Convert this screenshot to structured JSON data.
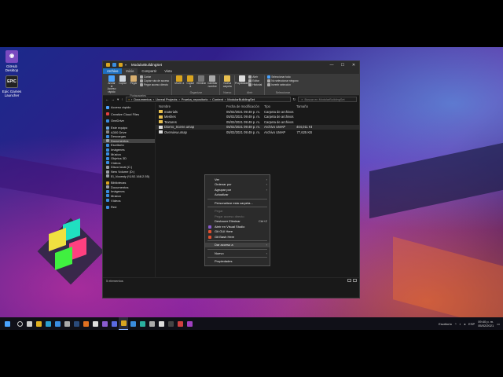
{
  "window": {
    "title": "ModularBuildingSet",
    "path": [
      "Documentos",
      "Unreal Projects",
      "Prueba_repositorio",
      "Content",
      "ModularBuildingSet"
    ],
    "search_placeholder": "Buscar en ModularBuildingSet",
    "status": "5 elementos"
  },
  "ribbon": {
    "tabs": [
      "Archivo",
      "Inicio",
      "Compartir",
      "Vista"
    ],
    "active_tab": "Inicio",
    "groups": [
      {
        "label": "Portapapeles",
        "buttons": [
          "Anclar al Acceso rápido",
          "Copiar",
          "Pegar"
        ],
        "small": [
          "Cortar",
          "Copiar ruta de acceso",
          "Pegar acceso directo"
        ]
      },
      {
        "label": "Organizar",
        "buttons": [
          "Mover a",
          "Copiar a",
          "Eliminar",
          "Cambiar nombre"
        ],
        "small": []
      },
      {
        "label": "Nuevo",
        "buttons": [
          "Nueva carpeta"
        ],
        "small": []
      },
      {
        "label": "Abrir",
        "buttons": [
          "Propiedades"
        ],
        "small": [
          "Abrir",
          "Editar",
          "Historial"
        ]
      },
      {
        "label": "Seleccionar",
        "buttons": [],
        "small": [
          "Seleccionar todo",
          "No seleccionar ninguno",
          "Invertir selección"
        ]
      }
    ]
  },
  "nav": [
    {
      "label": "Acceso rápido",
      "color": "#4aa3ff",
      "gap": false
    },
    {
      "label": "Creative Cloud Files",
      "color": "#e04040",
      "gap": true
    },
    {
      "label": "OneDrive",
      "color": "#3a8de0",
      "gap": true
    },
    {
      "label": "Este equipo",
      "color": "#6aa8e0",
      "gap": true
    },
    {
      "label": "A300 Drive",
      "color": "#888888",
      "gap": false
    },
    {
      "label": "Descargas",
      "color": "#3a8de0",
      "gap": false
    },
    {
      "label": "Documentos",
      "color": "#9aa0a8",
      "gap": false,
      "selected": true
    },
    {
      "label": "Escritorio",
      "color": "#3a8de0",
      "gap": false
    },
    {
      "label": "Imágenes",
      "color": "#3a8de0",
      "gap": false
    },
    {
      "label": "Música",
      "color": "#3a8de0",
      "gap": false
    },
    {
      "label": "Objetos 3D",
      "color": "#3a8de0",
      "gap": false
    },
    {
      "label": "Vídeos",
      "color": "#3a8de0",
      "gap": false
    },
    {
      "label": "Disco local (C:)",
      "color": "#9aa0a8",
      "gap": false
    },
    {
      "label": "New Volume (D:)",
      "color": "#9aa0a8",
      "gap": false
    },
    {
      "label": "El_Vocesty (\\\\192.168.2.55)",
      "color": "#9aa0a8",
      "gap": false
    },
    {
      "label": "Bibliotecas",
      "color": "#d9a520",
      "gap": true
    },
    {
      "label": "Documentos",
      "color": "#9aa0a8",
      "gap": false
    },
    {
      "label": "Imágenes",
      "color": "#3a8de0",
      "gap": false
    },
    {
      "label": "Música",
      "color": "#3a8de0",
      "gap": false
    },
    {
      "label": "Vídeos",
      "color": "#3a8de0",
      "gap": false
    },
    {
      "label": "Red",
      "color": "#3a8de0",
      "gap": true
    }
  ],
  "columns": [
    "Nombre",
    "Fecha de modificación",
    "Tipo",
    "Tamaño"
  ],
  "files": [
    {
      "name": "materials",
      "date": "05/02/2021 09:49 p. m.",
      "type": "Carpeta de archivos",
      "size": "",
      "kind": "folder"
    },
    {
      "name": "Meshes",
      "date": "05/02/2021 09:49 p. m.",
      "type": "Carpeta de archivos",
      "size": "",
      "kind": "folder"
    },
    {
      "name": "Textures",
      "date": "05/02/2021 09:49 p. m.",
      "type": "Carpeta de archivos",
      "size": "",
      "kind": "folder"
    },
    {
      "name": "Diorno_Scene.umap",
      "date": "05/02/2021 09:49 p. m.",
      "type": "Archivo UMAP",
      "size": "404,011 KB",
      "kind": "file"
    },
    {
      "name": "Overview.umap",
      "date": "05/02/2021 09:49 p. m.",
      "type": "Archivo UMAP",
      "size": "77,625 KB",
      "kind": "file"
    }
  ],
  "context_menu": [
    {
      "label": "Ver",
      "arrow": true
    },
    {
      "label": "Ordenar por",
      "arrow": true
    },
    {
      "label": "Agrupar por",
      "arrow": true
    },
    {
      "label": "Actualizar"
    },
    {
      "sep": true
    },
    {
      "label": "Personalizar esta carpeta..."
    },
    {
      "sep": true
    },
    {
      "label": "Pegar",
      "disabled": true
    },
    {
      "label": "Pegar acceso directo",
      "disabled": true
    },
    {
      "label": "Deshacer Eliminar",
      "shortcut": "Ctrl+Z"
    },
    {
      "label": "Abrir en Visual Studio",
      "icon": "#8a5cd0"
    },
    {
      "label": "Git GUI Here",
      "icon": "#e05030"
    },
    {
      "label": "Git Bash Here",
      "icon": "#e05030"
    },
    {
      "sep": true
    },
    {
      "label": "Dar acceso a",
      "arrow": true,
      "hover": true
    },
    {
      "sep": true
    },
    {
      "label": "Nuevo",
      "arrow": true
    },
    {
      "sep": true
    },
    {
      "label": "Propiedades"
    }
  ],
  "desktop_icons": [
    {
      "label": "Epic Games Launcher",
      "color": "#222222",
      "glyph": "EPIC"
    },
    {
      "label": "GitHub Desktop",
      "color": "#7a4ac0",
      "glyph": "◉"
    }
  ],
  "taskbar": {
    "icons": [
      {
        "name": "start-icon",
        "color": "#4aa3ff"
      },
      {
        "name": "search-icon",
        "color": "#cccccc"
      },
      {
        "name": "task-view-icon",
        "color": "#cccccc"
      },
      {
        "name": "chrome-icon",
        "color": "#e0b020"
      },
      {
        "name": "edge-icon",
        "color": "#2aa0d0"
      },
      {
        "name": "mail-icon",
        "color": "#3a8de0"
      },
      {
        "name": "store-icon",
        "color": "#aaaaaa"
      },
      {
        "name": "steam-icon",
        "color": "#2a4a7a"
      },
      {
        "name": "firefox-icon",
        "color": "#e07020"
      },
      {
        "name": "epic-icon",
        "color": "#dddddd"
      },
      {
        "name": "visual-studio-icon",
        "color": "#8a5cd0"
      },
      {
        "name": "discord-icon",
        "color": "#5a6ae0"
      },
      {
        "name": "explorer-icon",
        "color": "#d9a520",
        "active": true
      },
      {
        "name": "photos-icon",
        "color": "#3a8de0"
      },
      {
        "name": "edge-icon-2",
        "color": "#2ab0a0"
      },
      {
        "name": "settings-icon",
        "color": "#aaaaaa"
      },
      {
        "name": "unreal-icon",
        "color": "#dddddd"
      },
      {
        "name": "terminal-icon",
        "color": "#444444"
      },
      {
        "name": "chrome-icon-2",
        "color": "#d04040"
      },
      {
        "name": "media-icon",
        "color": "#a040c0"
      }
    ],
    "tray_text": "Escritorio",
    "lang": "ESP",
    "time": "09:40 p. m.",
    "date": "05/02/2021"
  }
}
